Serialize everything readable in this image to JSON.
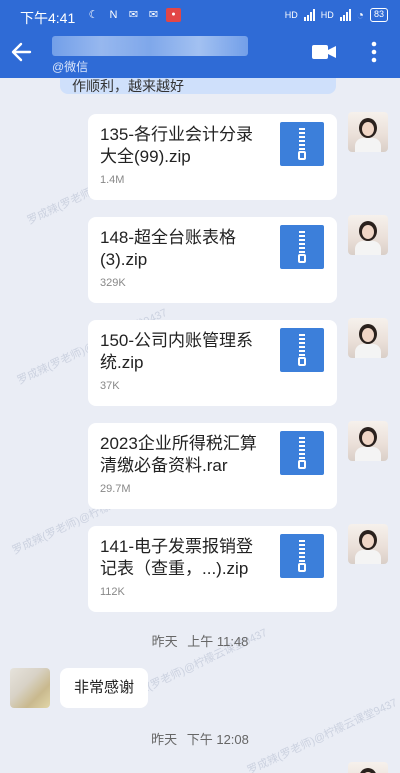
{
  "status_bar": {
    "time": "下午4:41",
    "network_1": "HD",
    "network_2": "HD",
    "battery": "83"
  },
  "header": {
    "subtitle": "@微信"
  },
  "partial_message": "作顺利，越来越好",
  "files": [
    {
      "name": "135-各行业会计分录大全(99).zip",
      "size": "1.4M"
    },
    {
      "name": "148-超全台账表格(3).zip",
      "size": "329K"
    },
    {
      "name": "150-公司内账管理系统.zip",
      "size": "37K"
    },
    {
      "name": "2023企业所得税汇算清缴必备资料.rar",
      "size": "29.7M"
    },
    {
      "name": "141-电子发票报销登记表（查重，...).zip",
      "size": "112K"
    }
  ],
  "timestamp_1": {
    "day": "昨天",
    "time": "上午 11:48"
  },
  "incoming_text": "非常感谢",
  "timestamp_2": {
    "day": "昨天",
    "time": "下午 12:08"
  },
  "watermark_text": "罗成辣(罗老师)@柠檬云课堂9437",
  "colors": {
    "header": "#2f6bd6",
    "file_icon": "#3c7fda",
    "background": "#eaedf5"
  }
}
